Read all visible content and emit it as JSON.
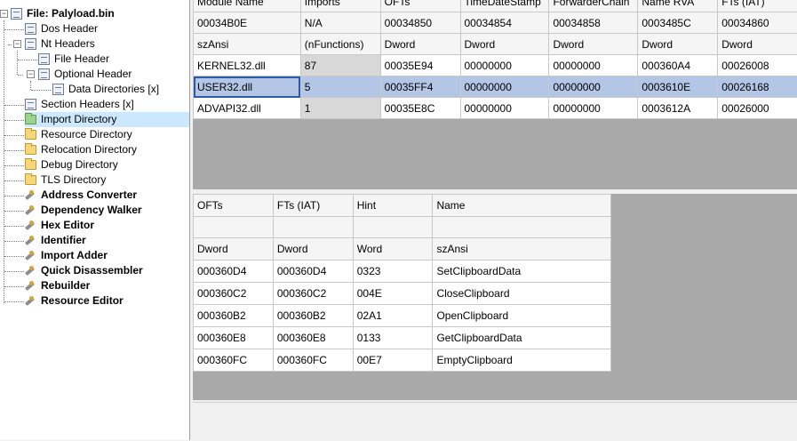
{
  "tree": {
    "root": "File: Palyload.bin",
    "dos_header": "Dos Header",
    "nt_headers": "Nt Headers",
    "file_header": "File Header",
    "optional_header": "Optional Header",
    "data_directories": "Data Directories [x]",
    "section_headers": "Section Headers [x]",
    "import_directory": "Import Directory",
    "resource_directory": "Resource Directory",
    "relocation_directory": "Relocation Directory",
    "debug_directory": "Debug Directory",
    "tls_directory": "TLS Directory",
    "tools": [
      "Address Converter",
      "Dependency Walker",
      "Hex Editor",
      "Identifier",
      "Import Adder",
      "Quick Disassembler",
      "Rebuilder",
      "Resource Editor"
    ]
  },
  "modules_table": {
    "headers": [
      "Module Name",
      "Imports",
      "OFTs",
      "TimeDateStamp",
      "ForwarderChain",
      "Name RVA",
      "FTs (IAT)"
    ],
    "row_offsets": [
      "00034B0E",
      "N/A",
      "00034850",
      "00034854",
      "00034858",
      "0003485C",
      "00034860"
    ],
    "row_types": [
      "szAnsi",
      "(nFunctions)",
      "Dword",
      "Dword",
      "Dword",
      "Dword",
      "Dword"
    ],
    "rows": [
      [
        "KERNEL32.dll",
        "87",
        "00035E94",
        "00000000",
        "00000000",
        "000360A4",
        "00026008"
      ],
      [
        "USER32.dll",
        "5",
        "00035FF4",
        "00000000",
        "00000000",
        "0003610E",
        "00026168"
      ],
      [
        "ADVAPI32.dll",
        "1",
        "00035E8C",
        "00000000",
        "00000000",
        "0003612A",
        "00026000"
      ]
    ],
    "selected_row": 1
  },
  "functions_table": {
    "headers": [
      "OFTs",
      "FTs (IAT)",
      "Hint",
      "Name"
    ],
    "types": [
      "Dword",
      "Dword",
      "Word",
      "szAnsi"
    ],
    "rows": [
      [
        "000360D4",
        "000360D4",
        "0323",
        "SetClipboardData"
      ],
      [
        "000360C2",
        "000360C2",
        "004E",
        "CloseClipboard"
      ],
      [
        "000360B2",
        "000360B2",
        "02A1",
        "OpenClipboard"
      ],
      [
        "000360E8",
        "000360E8",
        "0133",
        "GetClipboardData"
      ],
      [
        "000360FC",
        "000360FC",
        "00E7",
        "EmptyClipboard"
      ]
    ]
  }
}
